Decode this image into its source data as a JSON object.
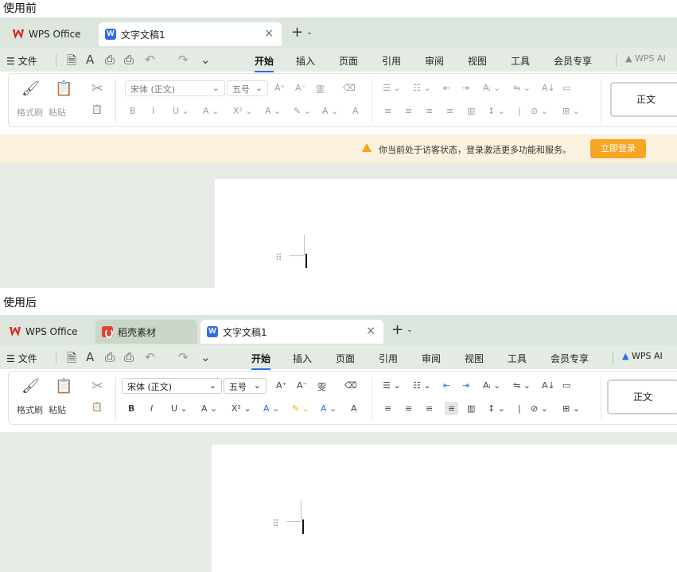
{
  "labels": {
    "before": "使用前",
    "after": "使用后"
  },
  "before": {
    "tabs": {
      "home": "WPS Office",
      "doc": "文字文稿1"
    },
    "menu": {
      "file": "文件",
      "items": [
        "开始",
        "插入",
        "页面",
        "引用",
        "审阅",
        "视图",
        "工具",
        "会员专享"
      ],
      "ai": "WPS AI"
    },
    "ribbon": {
      "format_painter": "格式刷",
      "paste": "粘贴",
      "font": "宋体 (正文)",
      "size": "五号",
      "style": "正文"
    },
    "notice": {
      "message": "你当前处于访客状态，登录激活更多功能和服务。",
      "button": "立即登录"
    }
  },
  "after": {
    "tabs": {
      "home": "WPS Office",
      "daoke": "稻壳素材",
      "doc": "文字文稿1"
    },
    "menu": {
      "file": "文件",
      "items": [
        "开始",
        "插入",
        "页面",
        "引用",
        "审阅",
        "视图",
        "工具",
        "会员专享"
      ],
      "ai": "WPS AI"
    },
    "ribbon": {
      "format_painter": "格式刷",
      "paste": "粘贴",
      "font": "宋体 (正文)",
      "size": "五号",
      "style": "正文"
    }
  },
  "icons": {
    "close": "×",
    "plus": "+",
    "chev": "⌄",
    "hamburger": "☰",
    "save": "🗎",
    "print": "⎙",
    "undo": "↶",
    "redo": "↷",
    "format": "A",
    "painter": "🖌",
    "paste": "📋",
    "cut": "✂"
  },
  "ribbon_glyphs": {
    "fmt_row1": [
      "A⁺",
      "A⁻",
      "雯",
      "⌫"
    ],
    "fmt_row2": [
      "B",
      "I",
      "U ⌄",
      "A ⌄",
      "X² ⌄",
      "A ⌄",
      "✎ ⌄",
      "A ⌄",
      "A"
    ],
    "para_row1": [
      "☰ ⌄",
      "☷ ⌄",
      "⇤",
      "⇥",
      "Aᵢ ⌄",
      "⇋ ⌄",
      "A↓",
      "▭"
    ],
    "para_row2": [
      "≡",
      "≡",
      "≡",
      "≡",
      "▥",
      "↕ ⌄",
      "|",
      "⊘ ⌄",
      "⊞ ⌄"
    ]
  },
  "colors": {
    "accent": "#2f6ce5",
    "notice_btn": "#f6a623",
    "wps_red": "#d9261c"
  }
}
